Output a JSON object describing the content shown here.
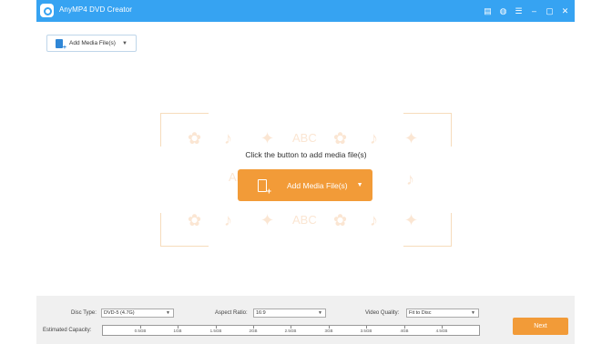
{
  "app": {
    "title": "AnyMP4 DVD Creator",
    "accent": "#36a3f2",
    "orange": "#f29b38"
  },
  "titlebar_icons": [
    {
      "name": "cart-icon",
      "glyph": "▤"
    },
    {
      "name": "feedback-icon",
      "glyph": "◍"
    },
    {
      "name": "menu-icon",
      "glyph": "☰"
    },
    {
      "name": "minimize-icon",
      "glyph": "–"
    },
    {
      "name": "maximize-icon",
      "glyph": "▢"
    },
    {
      "name": "close-icon",
      "glyph": "✕"
    }
  ],
  "toolbar": {
    "add_label": "Add Media File(s)",
    "caret": "▼"
  },
  "dropzone": {
    "hint": "Click the button to add media file(s)",
    "add_label": "Add Media File(s)",
    "caret": "▼",
    "bg_glyphs": [
      "ABC",
      "ABC",
      "ABC"
    ]
  },
  "bottom": {
    "disc_type_label": "Disc Type:",
    "disc_type_value": "DVD-5 (4.7G)",
    "aspect_label": "Aspect Ratio:",
    "aspect_value": "16:9",
    "quality_label": "Video Quality:",
    "quality_value": "Fit to Disc",
    "capacity_label": "Estimated Capacity:",
    "capacity_ticks": [
      "0.5GB",
      "1GB",
      "1.5GB",
      "2GB",
      "2.5GB",
      "3GB",
      "3.5GB",
      "4GB",
      "4.5GB"
    ],
    "next_label": "Next"
  }
}
